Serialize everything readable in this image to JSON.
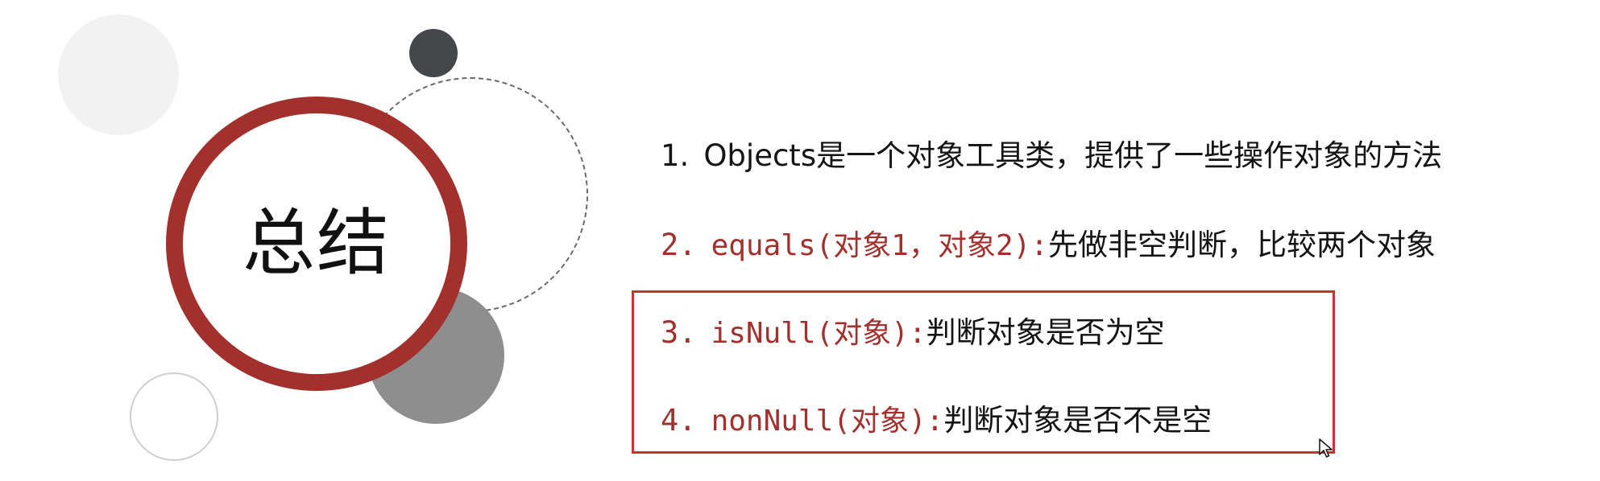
{
  "slide": {
    "title": "总结",
    "items": [
      {
        "number": "1.",
        "code": "",
        "text": "Objects是一个对象工具类，提供了一些操作对象的方法"
      },
      {
        "number": "2.",
        "code": "equals(对象1，对象2):",
        "text": "先做非空判断，比较两个对象"
      },
      {
        "number": "3.",
        "code": "isNull(对象):",
        "text": "判断对象是否为空"
      },
      {
        "number": "4.",
        "code": "nonNull(对象):",
        "text": "判断对象是否不是空"
      }
    ]
  },
  "colors": {
    "accent": "#a2302d",
    "highlight_border": "#c8332f",
    "text": "#141414"
  },
  "icons": {
    "cursor": "mouse-pointer-icon"
  }
}
